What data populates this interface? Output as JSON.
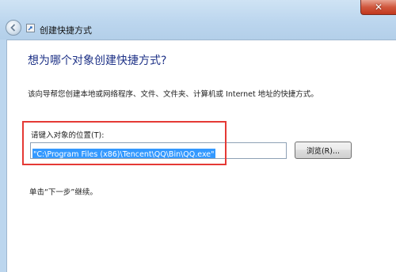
{
  "window": {
    "title": "创建快捷方式",
    "back_icon": "back-arrow-icon",
    "wizard_icon": "shortcut-wizard-icon",
    "close_symbol": "✕"
  },
  "main": {
    "heading": "想为哪个对象创建快捷方式?",
    "description": "该向导帮您创建本地或网络程序、文件、文件夹、计算机或 Internet 地址的快捷方式。",
    "location_label": "请键入对象的位置(T):",
    "location_value": "\"C:\\Program Files (x86)\\Tencent\\QQ\\Bin\\QQ.exe\"",
    "browse_label": "浏览(R)...",
    "hint": "单击“下一步”继续。"
  },
  "colors": {
    "highlight": "#e53935",
    "selection": "#3399ff",
    "heading": "#1e3287"
  }
}
